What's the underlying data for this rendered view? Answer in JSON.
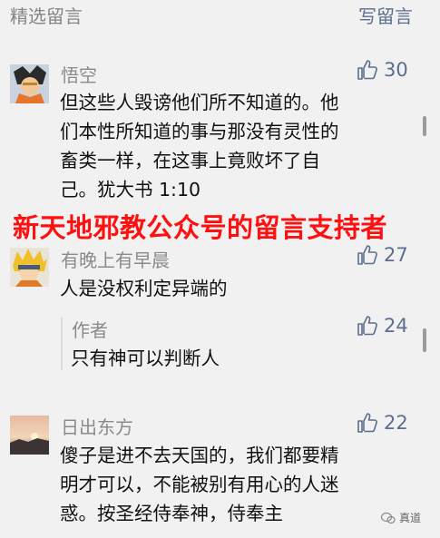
{
  "header": {
    "title": "精选留言",
    "write_label": "写留言"
  },
  "comments": [
    {
      "user": "悟空",
      "likes": "30",
      "lines": [
        "但这些人毁谤他们所不知道的。他",
        "们本性所知道的事与那没有灵性的",
        "畜类一样，在这事上竟败坏了自",
        "己。犹大书 1:10"
      ]
    },
    {
      "user": "有晚上有早晨",
      "likes": "27",
      "lines": [
        "人是没权利定异端的"
      ],
      "reply": {
        "author": "作者",
        "likes": "24",
        "text": "只有神可以判断人"
      }
    },
    {
      "user": "日出东方",
      "likes": "22",
      "lines": [
        "傻子是进不去天国的，我们都要精",
        "明才可以，不能被别有用心的人迷",
        "惑。按圣经侍奉神，侍奉主"
      ]
    }
  ],
  "banner": "新天地邪教公众号的留言支持者",
  "watermark": "真道",
  "colors": {
    "accent": "#5b6e8f",
    "banner": "#ff1010",
    "background": "#f1f1f1"
  },
  "icons": [
    "thumbs-up-icon",
    "avatar"
  ]
}
